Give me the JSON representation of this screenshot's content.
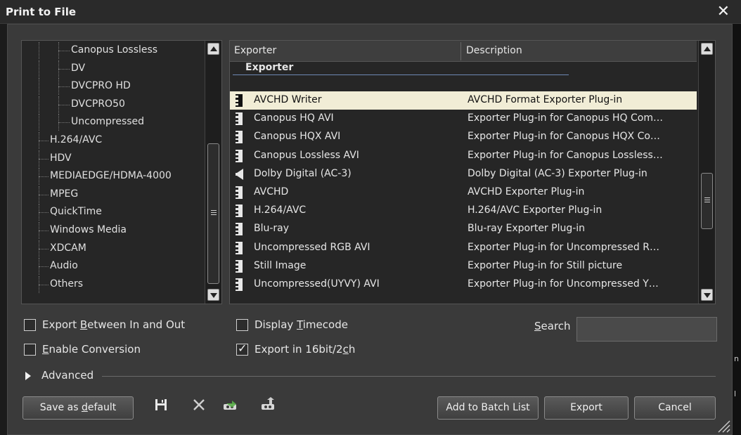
{
  "window": {
    "title": "Print to File",
    "close_glyph": "✕"
  },
  "tree": {
    "items": [
      {
        "label": "Canopus Lossless",
        "level": 2
      },
      {
        "label": "DV",
        "level": 2
      },
      {
        "label": "DVCPRO HD",
        "level": 2
      },
      {
        "label": "DVCPRO50",
        "level": 2
      },
      {
        "label": "Uncompressed",
        "level": 2
      },
      {
        "label": "H.264/AVC",
        "level": 1
      },
      {
        "label": "HDV",
        "level": 1
      },
      {
        "label": "MEDIAEDGE/HDMA-4000",
        "level": 1
      },
      {
        "label": "MPEG",
        "level": 1
      },
      {
        "label": "QuickTime",
        "level": 1
      },
      {
        "label": "Windows Media",
        "level": 1
      },
      {
        "label": "XDCAM",
        "level": 1
      },
      {
        "label": "Audio",
        "level": 1
      },
      {
        "label": "Others",
        "level": 1
      }
    ]
  },
  "table": {
    "headers": {
      "exporter": "Exporter",
      "description": "Description"
    },
    "group_label": "Exporter",
    "rows": [
      {
        "name": "AVCHD Writer",
        "description": "AVCHD Format Exporter Plug-in",
        "icon": "film-icon",
        "selected": true
      },
      {
        "name": "Canopus HQ AVI",
        "description": "Exporter Plug-in for Canopus HQ Com…",
        "icon": "film-icon"
      },
      {
        "name": "Canopus HQX AVI",
        "description": "Exporter Plug-in for Canopus HQX Co…",
        "icon": "film-icon"
      },
      {
        "name": "Canopus Lossless AVI",
        "description": "Exporter Plug-in for Canopus Lossless…",
        "icon": "film-icon"
      },
      {
        "name": "Dolby Digital (AC-3)",
        "description": "Dolby Digital (AC-3) Exporter Plug-in",
        "icon": "speaker-icon"
      },
      {
        "name": "AVCHD",
        "description": "AVCHD Exporter Plug-in",
        "icon": "film-icon"
      },
      {
        "name": "H.264/AVC",
        "description": "H.264/AVC Exporter Plug-in",
        "icon": "film-icon"
      },
      {
        "name": "Blu-ray",
        "description": "Blu-ray Exporter Plug-in",
        "icon": "film-icon"
      },
      {
        "name": "Uncompressed RGB AVI",
        "description": "Exporter Plug-in for Uncompressed R…",
        "icon": "film-icon"
      },
      {
        "name": "Still Image",
        "description": "Exporter Plug-in for Still picture",
        "icon": "film-icon"
      },
      {
        "name": "Uncompressed(UYVY) AVI",
        "description": "Exporter Plug-in for Uncompressed Y…",
        "icon": "film-icon"
      }
    ]
  },
  "options": {
    "export_between": {
      "label_pre": "Export ",
      "label_u": "B",
      "label_post": "etween In and Out",
      "checked": false
    },
    "enable_conversion": {
      "label_pre": "",
      "label_u": "E",
      "label_post": "nable Conversion",
      "checked": false
    },
    "display_timecode": {
      "label_pre": "Display ",
      "label_u": "T",
      "label_post": "imecode",
      "checked": false
    },
    "export_16bit": {
      "label_pre": "Export in 16bit/2",
      "label_u": "c",
      "label_post": "h",
      "checked": true
    }
  },
  "search": {
    "label_u": "S",
    "label_post": "earch",
    "value": ""
  },
  "advanced": {
    "label": "Advanced"
  },
  "buttons": {
    "save_default_pre": "Save as ",
    "save_default_u": "d",
    "save_default_post": "efault",
    "add_batch": "Add to Batch List",
    "export": "Export",
    "cancel": "Cancel"
  },
  "right_strip_glyphs": [
    "n",
    "l",
    "i",
    "n"
  ]
}
